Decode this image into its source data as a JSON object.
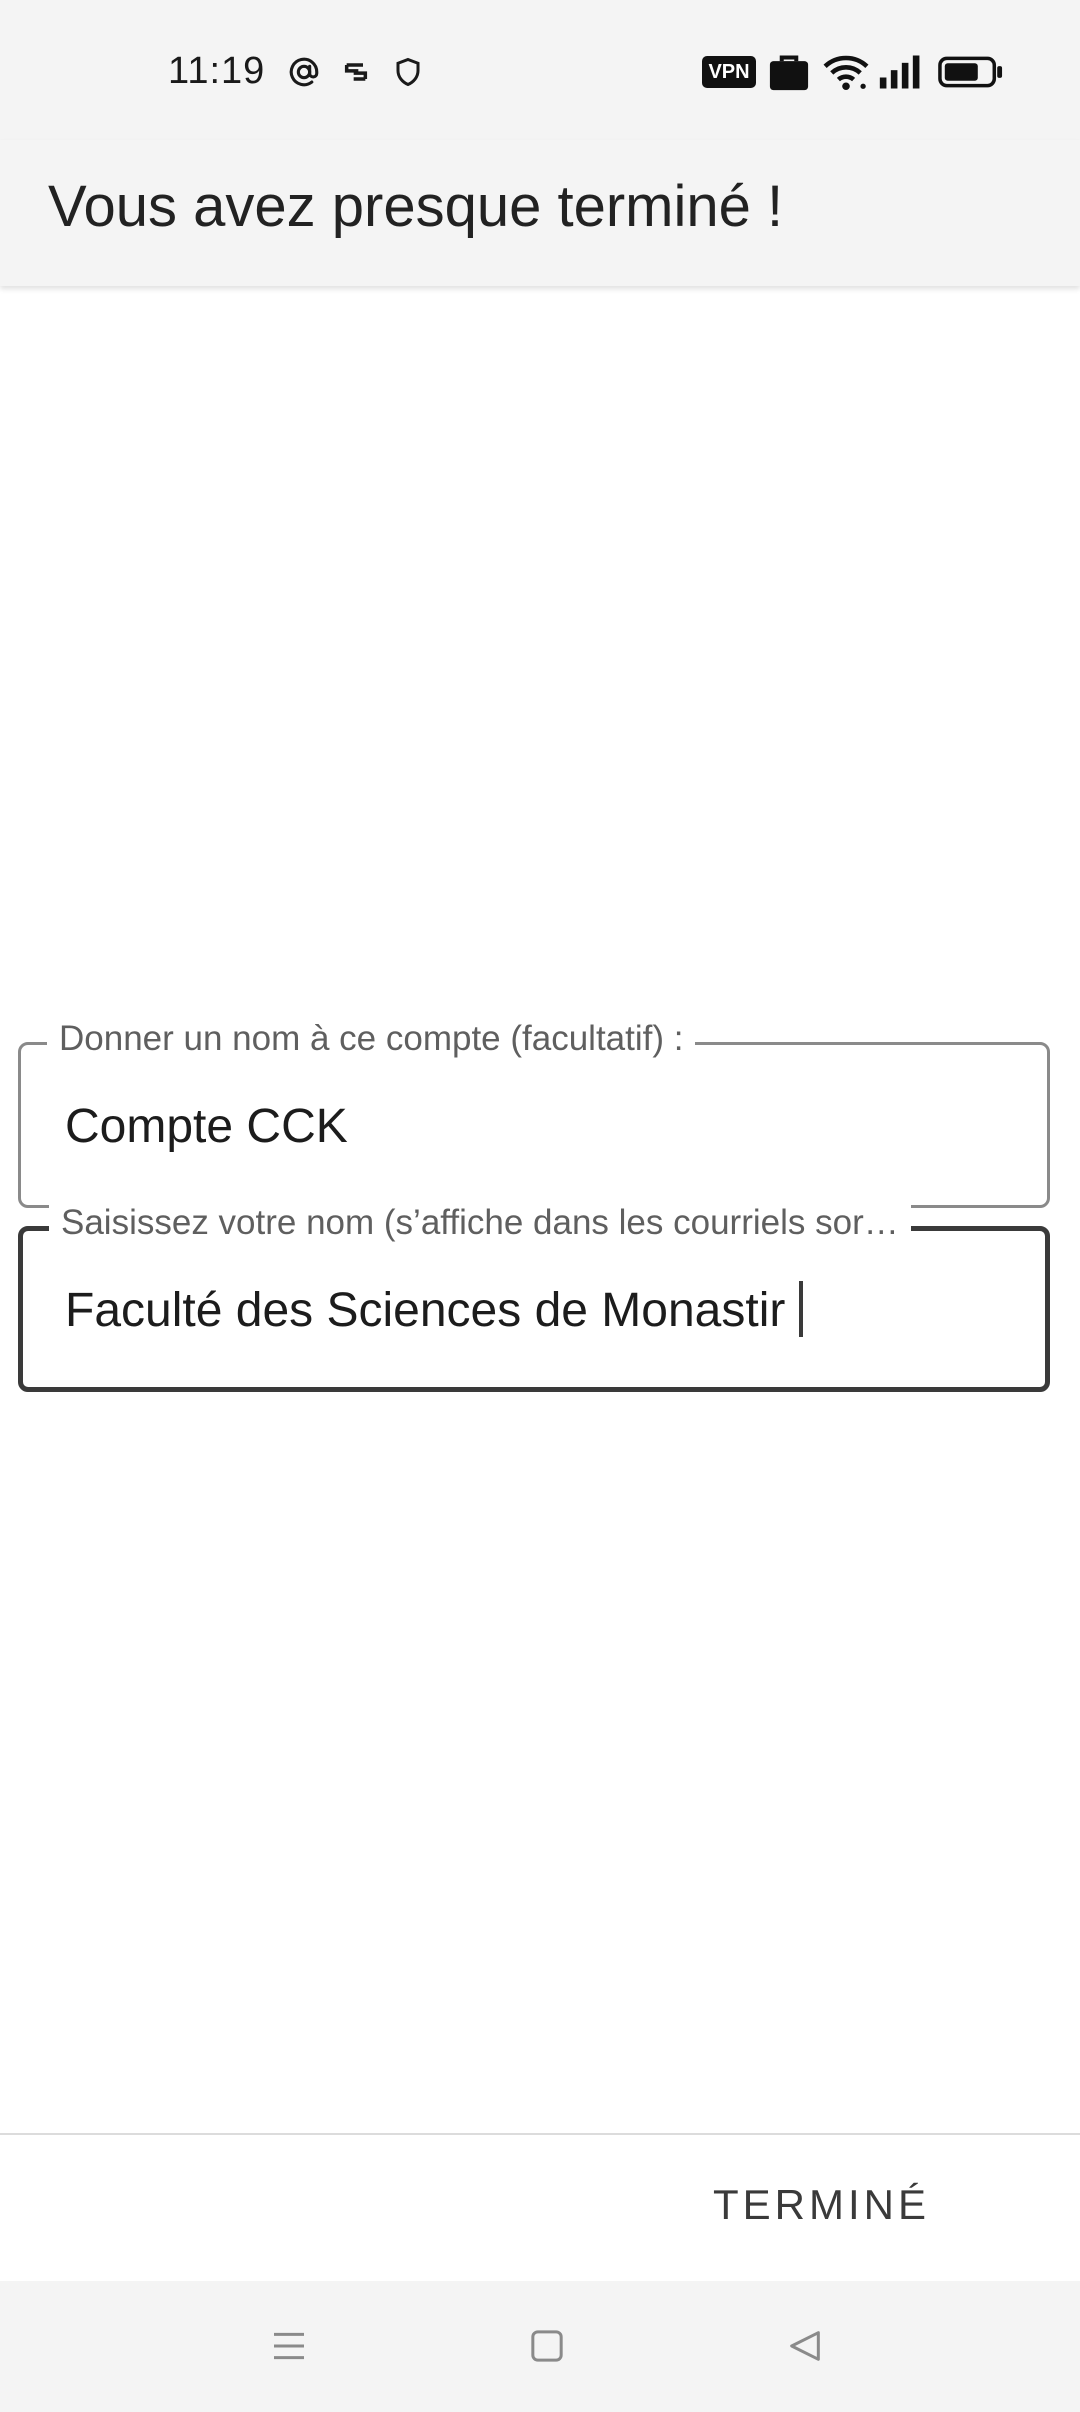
{
  "status_bar": {
    "time": "11:19",
    "left_icons": [
      "at-sign-icon",
      "link-icon",
      "shield-icon"
    ],
    "vpn_label": "VPN",
    "right_icons": [
      "briefcase-icon",
      "wifi-icon",
      "signal-icon",
      "battery-icon"
    ]
  },
  "app_bar": {
    "title": "Vous avez presque terminé !"
  },
  "form": {
    "account_name": {
      "label": "Donner un nom à ce compte (facultatif) :",
      "value": "Compte CCK"
    },
    "your_name": {
      "label": "Saisissez votre nom (s’affiche dans les courriels sor…",
      "value": "Faculté des Sciences de Monastir"
    }
  },
  "actions": {
    "done_label": "TERMINÉ"
  },
  "nav_bar": {
    "buttons": [
      "menu-icon",
      "home-icon",
      "back-icon"
    ]
  },
  "colors": {
    "bar_background": "#f4f4f4",
    "focused_border": "#3a3a3a",
    "idle_border": "#8a8a8a",
    "label_text": "#5f5f5f"
  }
}
